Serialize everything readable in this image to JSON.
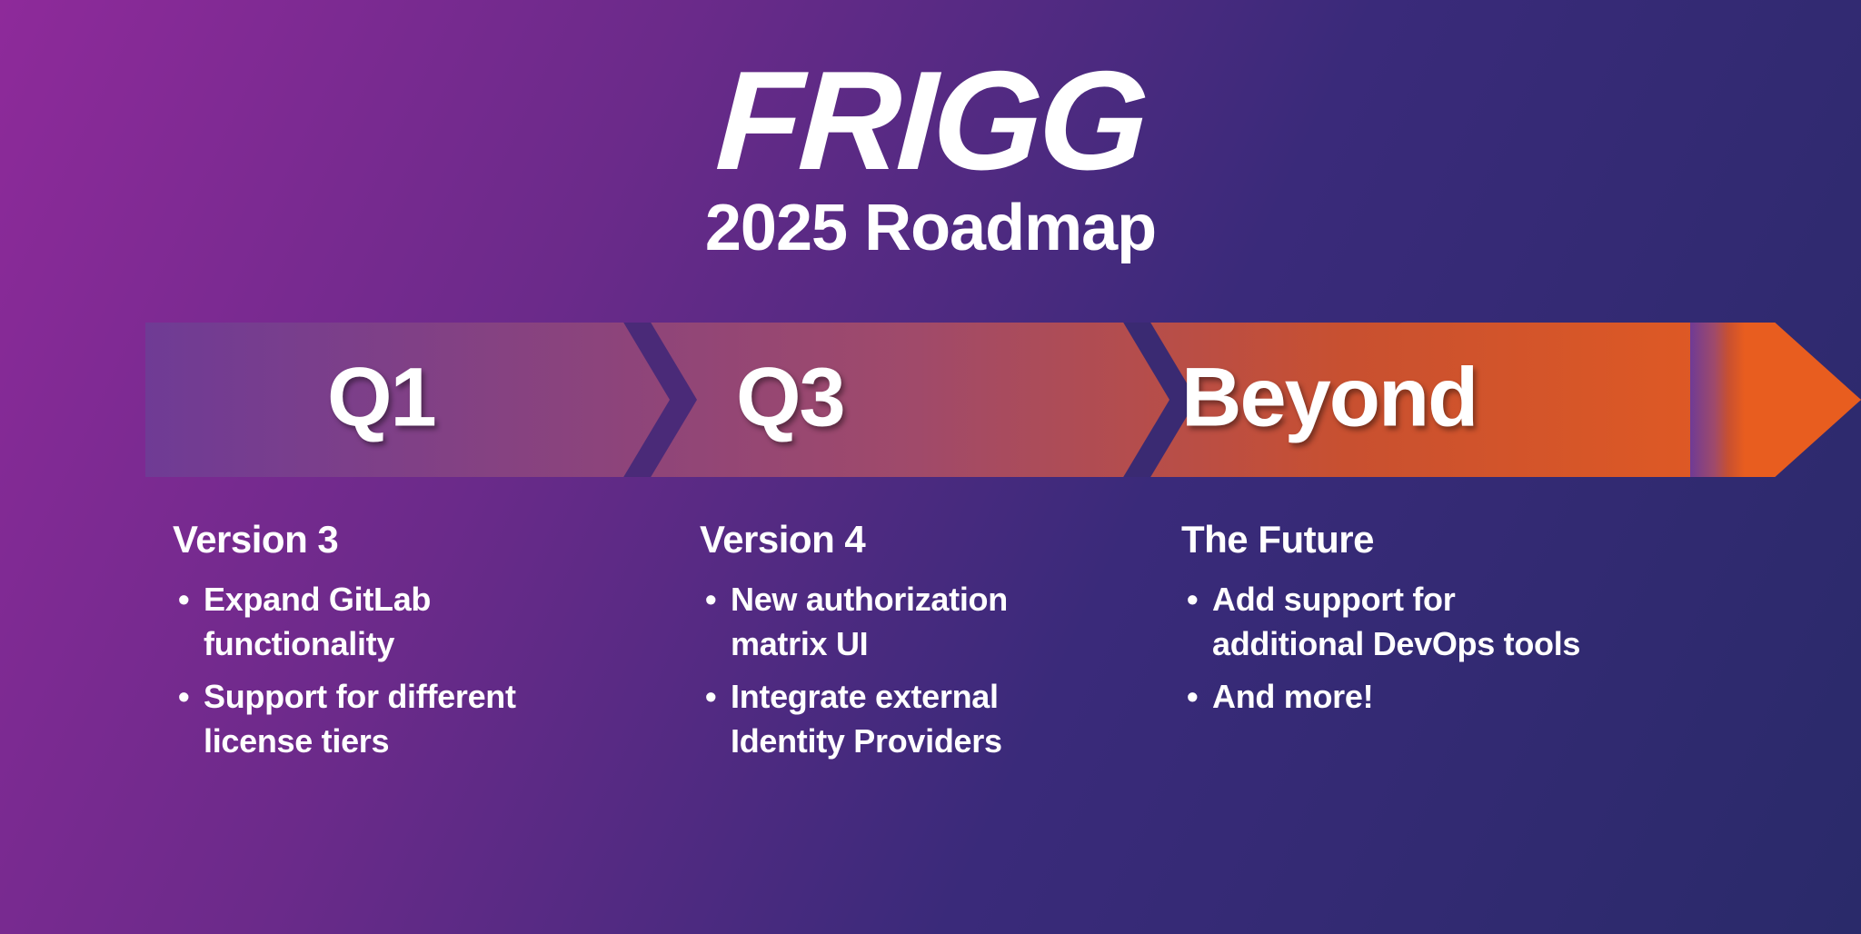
{
  "header": {
    "title": "FRIGG",
    "subtitle": "2025 Roadmap"
  },
  "segments": [
    {
      "label": "Q1"
    },
    {
      "label": "Q3"
    },
    {
      "label": "Beyond"
    }
  ],
  "columns": [
    {
      "title": "Version 3",
      "items": [
        "Expand GitLab functionality",
        "Support for different license tiers"
      ]
    },
    {
      "title": "Version 4",
      "items": [
        "New authorization matrix UI",
        "Integrate external Identity Providers"
      ]
    },
    {
      "title": "The Future",
      "items": [
        "Add support for additional DevOps tools",
        "And more!"
      ]
    }
  ],
  "colors": {
    "arrow_start": "#6f3b95",
    "arrow_mid": "#b34b55",
    "arrow_end": "#e85d1f"
  }
}
